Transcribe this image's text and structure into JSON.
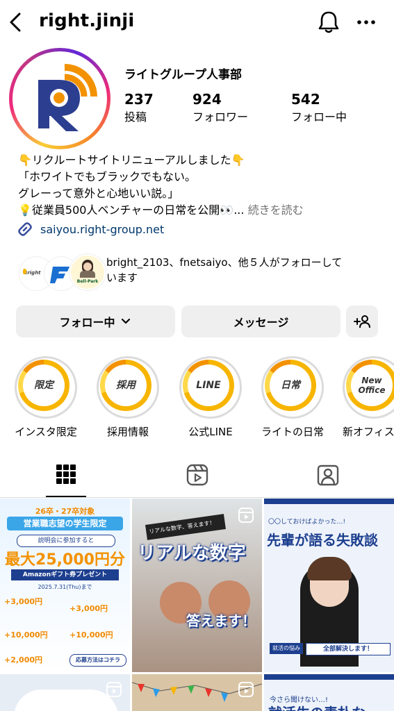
{
  "header": {
    "username": "right.jinji"
  },
  "profile": {
    "display_name": "ライトグループ人事部",
    "stats": [
      {
        "value": "237",
        "label": "投稿"
      },
      {
        "value": "924",
        "label": "フォロワー"
      },
      {
        "value": "542",
        "label": "フォロー中"
      }
    ],
    "bio": {
      "line1": "👇リクルートサイトリニューアルしました👇",
      "line2": "「ホワイトでもブラックでもない。",
      "line3": "グレーって意外と心地いい説。」",
      "line4": "💡従業員500人ベンチャーの日常を公開👀...",
      "more": "続きを読む"
    },
    "link": "saiyou.right-group.net",
    "followed_by": {
      "text1": "bright_2103、fnetsaiyo、他５人がフォローして",
      "text2": "います",
      "mini1_label": "Bright",
      "mini3_label": "Bell-Park"
    }
  },
  "actions": {
    "following": "フォロー中",
    "message": "メッセージ"
  },
  "highlights": [
    {
      "art": "限定",
      "label": "インスタ限定"
    },
    {
      "art": "採用",
      "label": "採用情報"
    },
    {
      "art": "LINE",
      "label": "公式LINE"
    },
    {
      "art": "日常",
      "label": "ライトの日常"
    },
    {
      "art": "New Office",
      "label": "新オフィス"
    }
  ],
  "posts": {
    "p1": {
      "top": "26卒・27卒対象",
      "banner": "営業職志望の学生限定",
      "sub": "説明会に参加すると",
      "amount": "最大25,000円分",
      "gift": "Amazonギフト券プレゼント",
      "date": "2025.7.31(Thu)まで",
      "items": [
        "+3,000円",
        "+3,000円",
        "+10,000円",
        "+10,000円",
        "+2,000円"
      ],
      "cta": "応募方法はコチラ"
    },
    "p2": {
      "small": "リアルな数字、答えます！",
      "big": "リアルな数字",
      "answer": "答えます！"
    },
    "p3": {
      "small": "〇〇しておけばよかった…!",
      "title": "先輩が語る失敗談",
      "tag": "就活の悩み",
      "cta": "全部解決します！"
    },
    "p6": {
      "small": "今さら聞けない…!",
      "title": "就活生の素朴な"
    }
  }
}
